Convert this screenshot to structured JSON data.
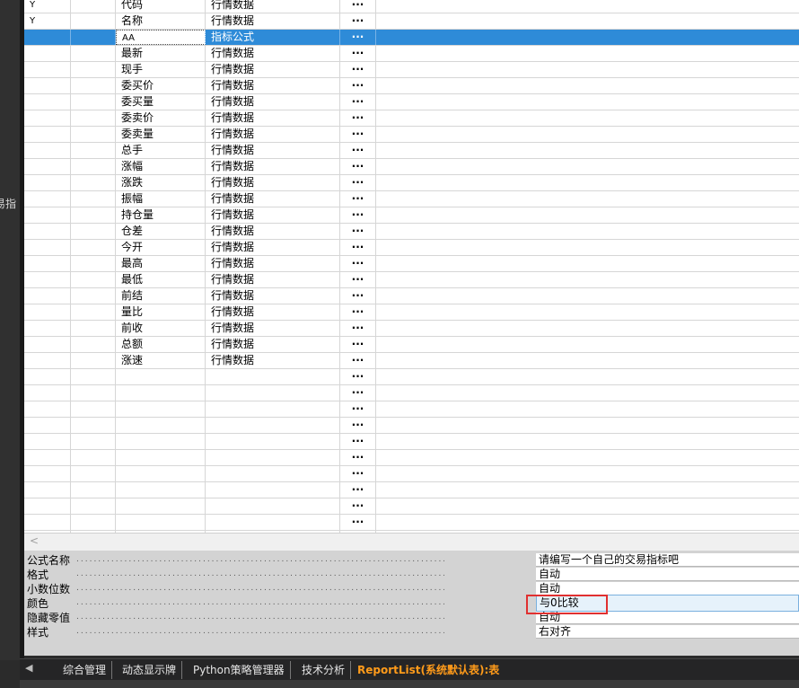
{
  "sidebar": {
    "vertical_text": "易指"
  },
  "table": {
    "rows": [
      {
        "flag": "Y",
        "name": "代码",
        "type": "行情数据",
        "btn": "···"
      },
      {
        "flag": "Y",
        "name": "名称",
        "type": "行情数据",
        "btn": "···"
      },
      {
        "flag": "",
        "name": "AA",
        "type": "指标公式",
        "btn": "···",
        "selected": true
      },
      {
        "flag": "",
        "name": "最新",
        "type": "行情数据",
        "btn": "···"
      },
      {
        "flag": "",
        "name": "现手",
        "type": "行情数据",
        "btn": "···"
      },
      {
        "flag": "",
        "name": "委买价",
        "type": "行情数据",
        "btn": "···"
      },
      {
        "flag": "",
        "name": "委买量",
        "type": "行情数据",
        "btn": "···"
      },
      {
        "flag": "",
        "name": "委卖价",
        "type": "行情数据",
        "btn": "···"
      },
      {
        "flag": "",
        "name": "委卖量",
        "type": "行情数据",
        "btn": "···"
      },
      {
        "flag": "",
        "name": "总手",
        "type": "行情数据",
        "btn": "···"
      },
      {
        "flag": "",
        "name": "涨幅",
        "type": "行情数据",
        "btn": "···"
      },
      {
        "flag": "",
        "name": "涨跌",
        "type": "行情数据",
        "btn": "···"
      },
      {
        "flag": "",
        "name": "振幅",
        "type": "行情数据",
        "btn": "···"
      },
      {
        "flag": "",
        "name": "持仓量",
        "type": "行情数据",
        "btn": "···"
      },
      {
        "flag": "",
        "name": "仓差",
        "type": "行情数据",
        "btn": "···"
      },
      {
        "flag": "",
        "name": "今开",
        "type": "行情数据",
        "btn": "···"
      },
      {
        "flag": "",
        "name": "最高",
        "type": "行情数据",
        "btn": "···"
      },
      {
        "flag": "",
        "name": "最低",
        "type": "行情数据",
        "btn": "···"
      },
      {
        "flag": "",
        "name": "前结",
        "type": "行情数据",
        "btn": "···"
      },
      {
        "flag": "",
        "name": "量比",
        "type": "行情数据",
        "btn": "···"
      },
      {
        "flag": "",
        "name": "前收",
        "type": "行情数据",
        "btn": "···"
      },
      {
        "flag": "",
        "name": "总额",
        "type": "行情数据",
        "btn": "···"
      },
      {
        "flag": "",
        "name": "涨速",
        "type": "行情数据",
        "btn": "···"
      },
      {
        "flag": "",
        "name": "",
        "type": "",
        "btn": "···"
      },
      {
        "flag": "",
        "name": "",
        "type": "",
        "btn": "···"
      },
      {
        "flag": "",
        "name": "",
        "type": "",
        "btn": "···"
      },
      {
        "flag": "",
        "name": "",
        "type": "",
        "btn": "···"
      },
      {
        "flag": "",
        "name": "",
        "type": "",
        "btn": "···"
      },
      {
        "flag": "",
        "name": "",
        "type": "",
        "btn": "···"
      },
      {
        "flag": "",
        "name": "",
        "type": "",
        "btn": "···"
      },
      {
        "flag": "",
        "name": "",
        "type": "",
        "btn": "···"
      },
      {
        "flag": "",
        "name": "",
        "type": "",
        "btn": "···"
      },
      {
        "flag": "",
        "name": "",
        "type": "",
        "btn": "···"
      },
      {
        "flag": "",
        "name": "",
        "type": "",
        "btn": "···"
      }
    ]
  },
  "scrollbar": {
    "left_arrow": "<"
  },
  "properties": {
    "dots": "......................................................................................................",
    "rows": [
      {
        "label": "公式名称",
        "value": "请编写一个自己的交易指标吧"
      },
      {
        "label": "格式",
        "value": "自动"
      },
      {
        "label": "小数位数",
        "value": "自动"
      },
      {
        "label": "颜色",
        "value": "与0比较",
        "editing": true
      },
      {
        "label": "隐藏零值",
        "value": "自动"
      },
      {
        "label": "样式",
        "value": "右对齐"
      }
    ]
  },
  "tabs": {
    "nav": "◀",
    "items": [
      "综合管理",
      "动态显示牌",
      "Python策略管理器",
      "技术分析",
      "ReportList(系统默认表):表"
    ],
    "active_index": 4
  },
  "colors": {
    "selected_row": "#2e8bd8",
    "active_tab": "#ff9b1a",
    "highlight_box": "#e03030"
  }
}
